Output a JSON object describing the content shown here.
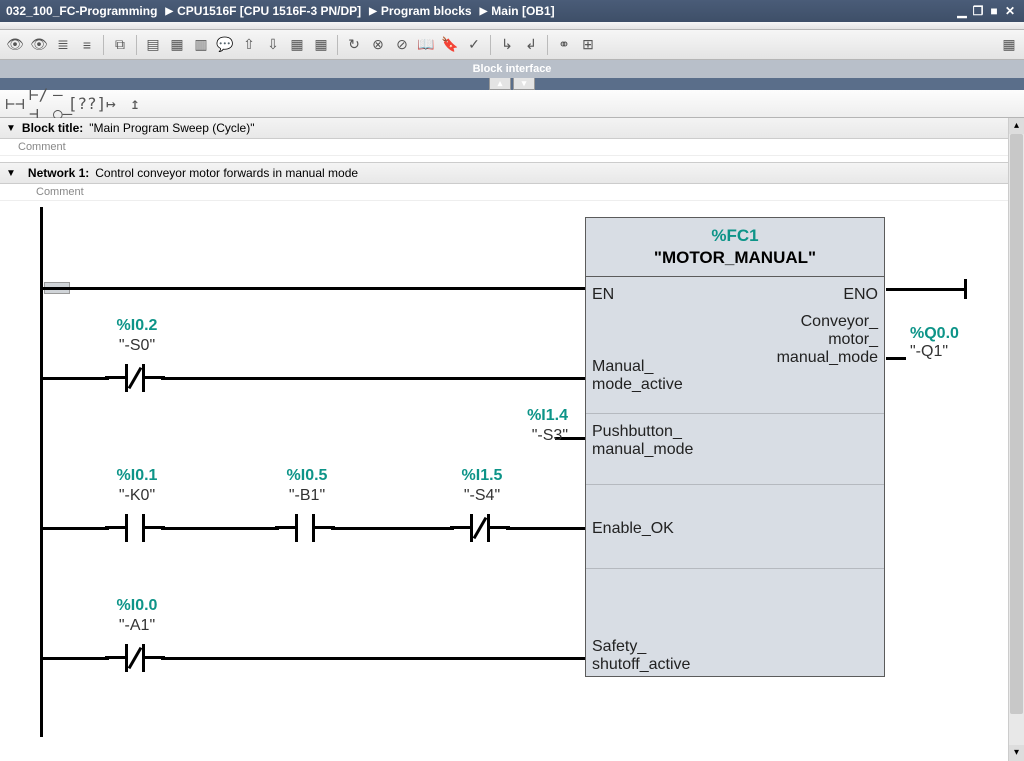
{
  "breadcrumb": [
    "032_100_FC-Programming",
    "CPU1516F [CPU 1516F-3 PN/DP]",
    "Program blocks",
    "Main [OB1]"
  ],
  "blockInterfaceLabel": "Block interface",
  "blockTitle": {
    "label": "Block title:",
    "value": "\"Main Program Sweep (Cycle)\"",
    "comment": "Comment"
  },
  "network": {
    "label": "Network 1:",
    "title": "Control conveyor motor forwards in manual mode",
    "comment": "Comment"
  },
  "fc": {
    "addr": "%FC1",
    "name": "\"MOTOR_MANUAL\"",
    "pins": {
      "en": "EN",
      "eno": "ENO",
      "manual": "Manual_\nmode_active",
      "pushbutton": "Pushbutton_\nmanual_mode",
      "enable": "Enable_OK",
      "safety": "Safety_\nshutoff_active",
      "out": "Conveyor_\nmotor_\nmanual_mode"
    }
  },
  "contacts": {
    "s0": {
      "addr": "%I0.2",
      "sym": "\"-S0\""
    },
    "s3": {
      "addr": "%I1.4",
      "sym": "\"-S3\""
    },
    "k0": {
      "addr": "%I0.1",
      "sym": "\"-K0\""
    },
    "b1": {
      "addr": "%I0.5",
      "sym": "\"-B1\""
    },
    "s4": {
      "addr": "%I1.5",
      "sym": "\"-S4\""
    },
    "a1": {
      "addr": "%I0.0",
      "sym": "\"-A1\""
    }
  },
  "output": {
    "addr": "%Q0.0",
    "sym": "\"-Q1\""
  }
}
